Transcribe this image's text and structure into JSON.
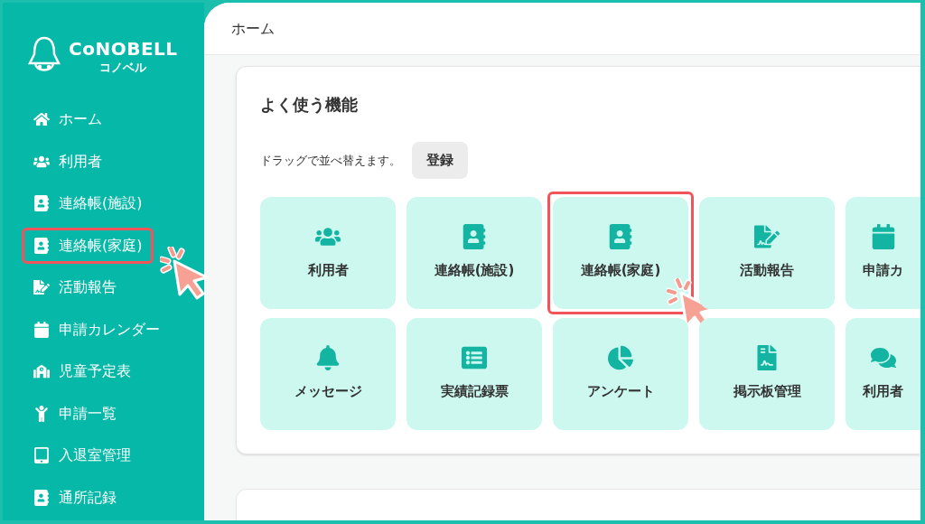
{
  "logo": {
    "name": "CoNOBELL",
    "reading": "コノベル"
  },
  "sidebar": {
    "items": [
      {
        "label": "ホーム",
        "highlighted": false
      },
      {
        "label": "利用者",
        "highlighted": false
      },
      {
        "label": "連絡帳(施設)",
        "highlighted": false
      },
      {
        "label": "連絡帳(家庭)",
        "highlighted": true
      },
      {
        "label": "活動報告",
        "highlighted": false
      },
      {
        "label": "申請カレンダー",
        "highlighted": false
      },
      {
        "label": "児童予定表",
        "highlighted": false
      },
      {
        "label": "申請一覧",
        "highlighted": false
      },
      {
        "label": "入退室管理",
        "highlighted": false
      },
      {
        "label": "通所記録",
        "highlighted": false
      }
    ]
  },
  "header": {
    "title": "ホーム"
  },
  "favorites": {
    "title": "よく使う機能",
    "hint": "ドラッグで並べ替えます。",
    "register_button": "登録",
    "tiles": [
      {
        "label": "利用者",
        "highlighted": false
      },
      {
        "label": "連絡帳(施設)",
        "highlighted": false
      },
      {
        "label": "連絡帳(家庭)",
        "highlighted": true
      },
      {
        "label": "活動報告",
        "highlighted": false
      },
      {
        "label": "申請カ",
        "highlighted": false
      },
      {
        "label": "メッセージ",
        "highlighted": false
      },
      {
        "label": "実績記録票",
        "highlighted": false
      },
      {
        "label": "アンケート",
        "highlighted": false
      },
      {
        "label": "掲示板管理",
        "highlighted": false
      },
      {
        "label": "利用者",
        "highlighted": false
      }
    ]
  }
}
